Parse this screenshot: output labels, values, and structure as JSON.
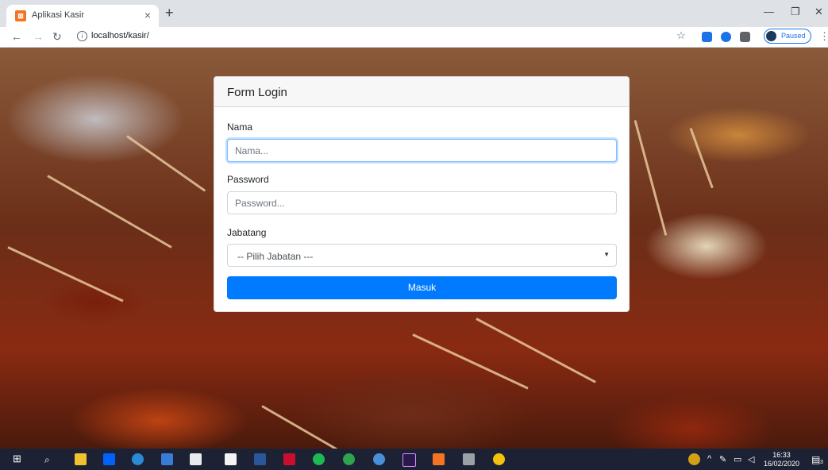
{
  "browser": {
    "tab_title": "Aplikasi Kasir",
    "tab_favicon": "xampp-icon",
    "url": "localhost/kasir/",
    "profile_status": "Paused"
  },
  "form": {
    "title": "Form Login",
    "nama_label": "Nama",
    "nama_placeholder": "Nama...",
    "password_label": "Password",
    "password_placeholder": "Password...",
    "jabatan_label": "Jabatang",
    "jabatan_selected": "-- Pilih Jabatan ---",
    "submit_label": "Masuk"
  },
  "taskbar": {
    "time": "16:33",
    "date": "16/02/2020",
    "notification_count": "3"
  },
  "colors": {
    "primary": "#007bff",
    "taskbar": "#1c2233"
  }
}
